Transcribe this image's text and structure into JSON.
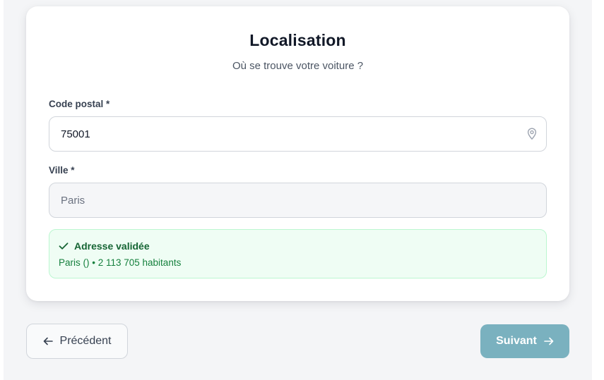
{
  "colors": {
    "background": "#f4f5f7",
    "card": "#ffffff",
    "success_bg": "#effdf4",
    "success_border": "#bbf7d0",
    "success_text": "#166534",
    "next_button": "#7ab1bf"
  },
  "header": {
    "title": "Localisation",
    "subtitle": "Où se trouve votre voiture ?"
  },
  "form": {
    "postal_code": {
      "label": "Code postal *",
      "value": "75001",
      "icon": "map-pin-icon"
    },
    "city": {
      "label": "Ville *",
      "value": "Paris",
      "disabled": true
    }
  },
  "validation": {
    "icon": "check-icon",
    "title": "Adresse validée",
    "detail": "Paris ()  • 2 113 705 habitants"
  },
  "navigation": {
    "prev_label": "Précédent",
    "prev_icon": "arrow-left-icon",
    "next_label": "Suivant",
    "next_icon": "arrow-right-icon"
  }
}
